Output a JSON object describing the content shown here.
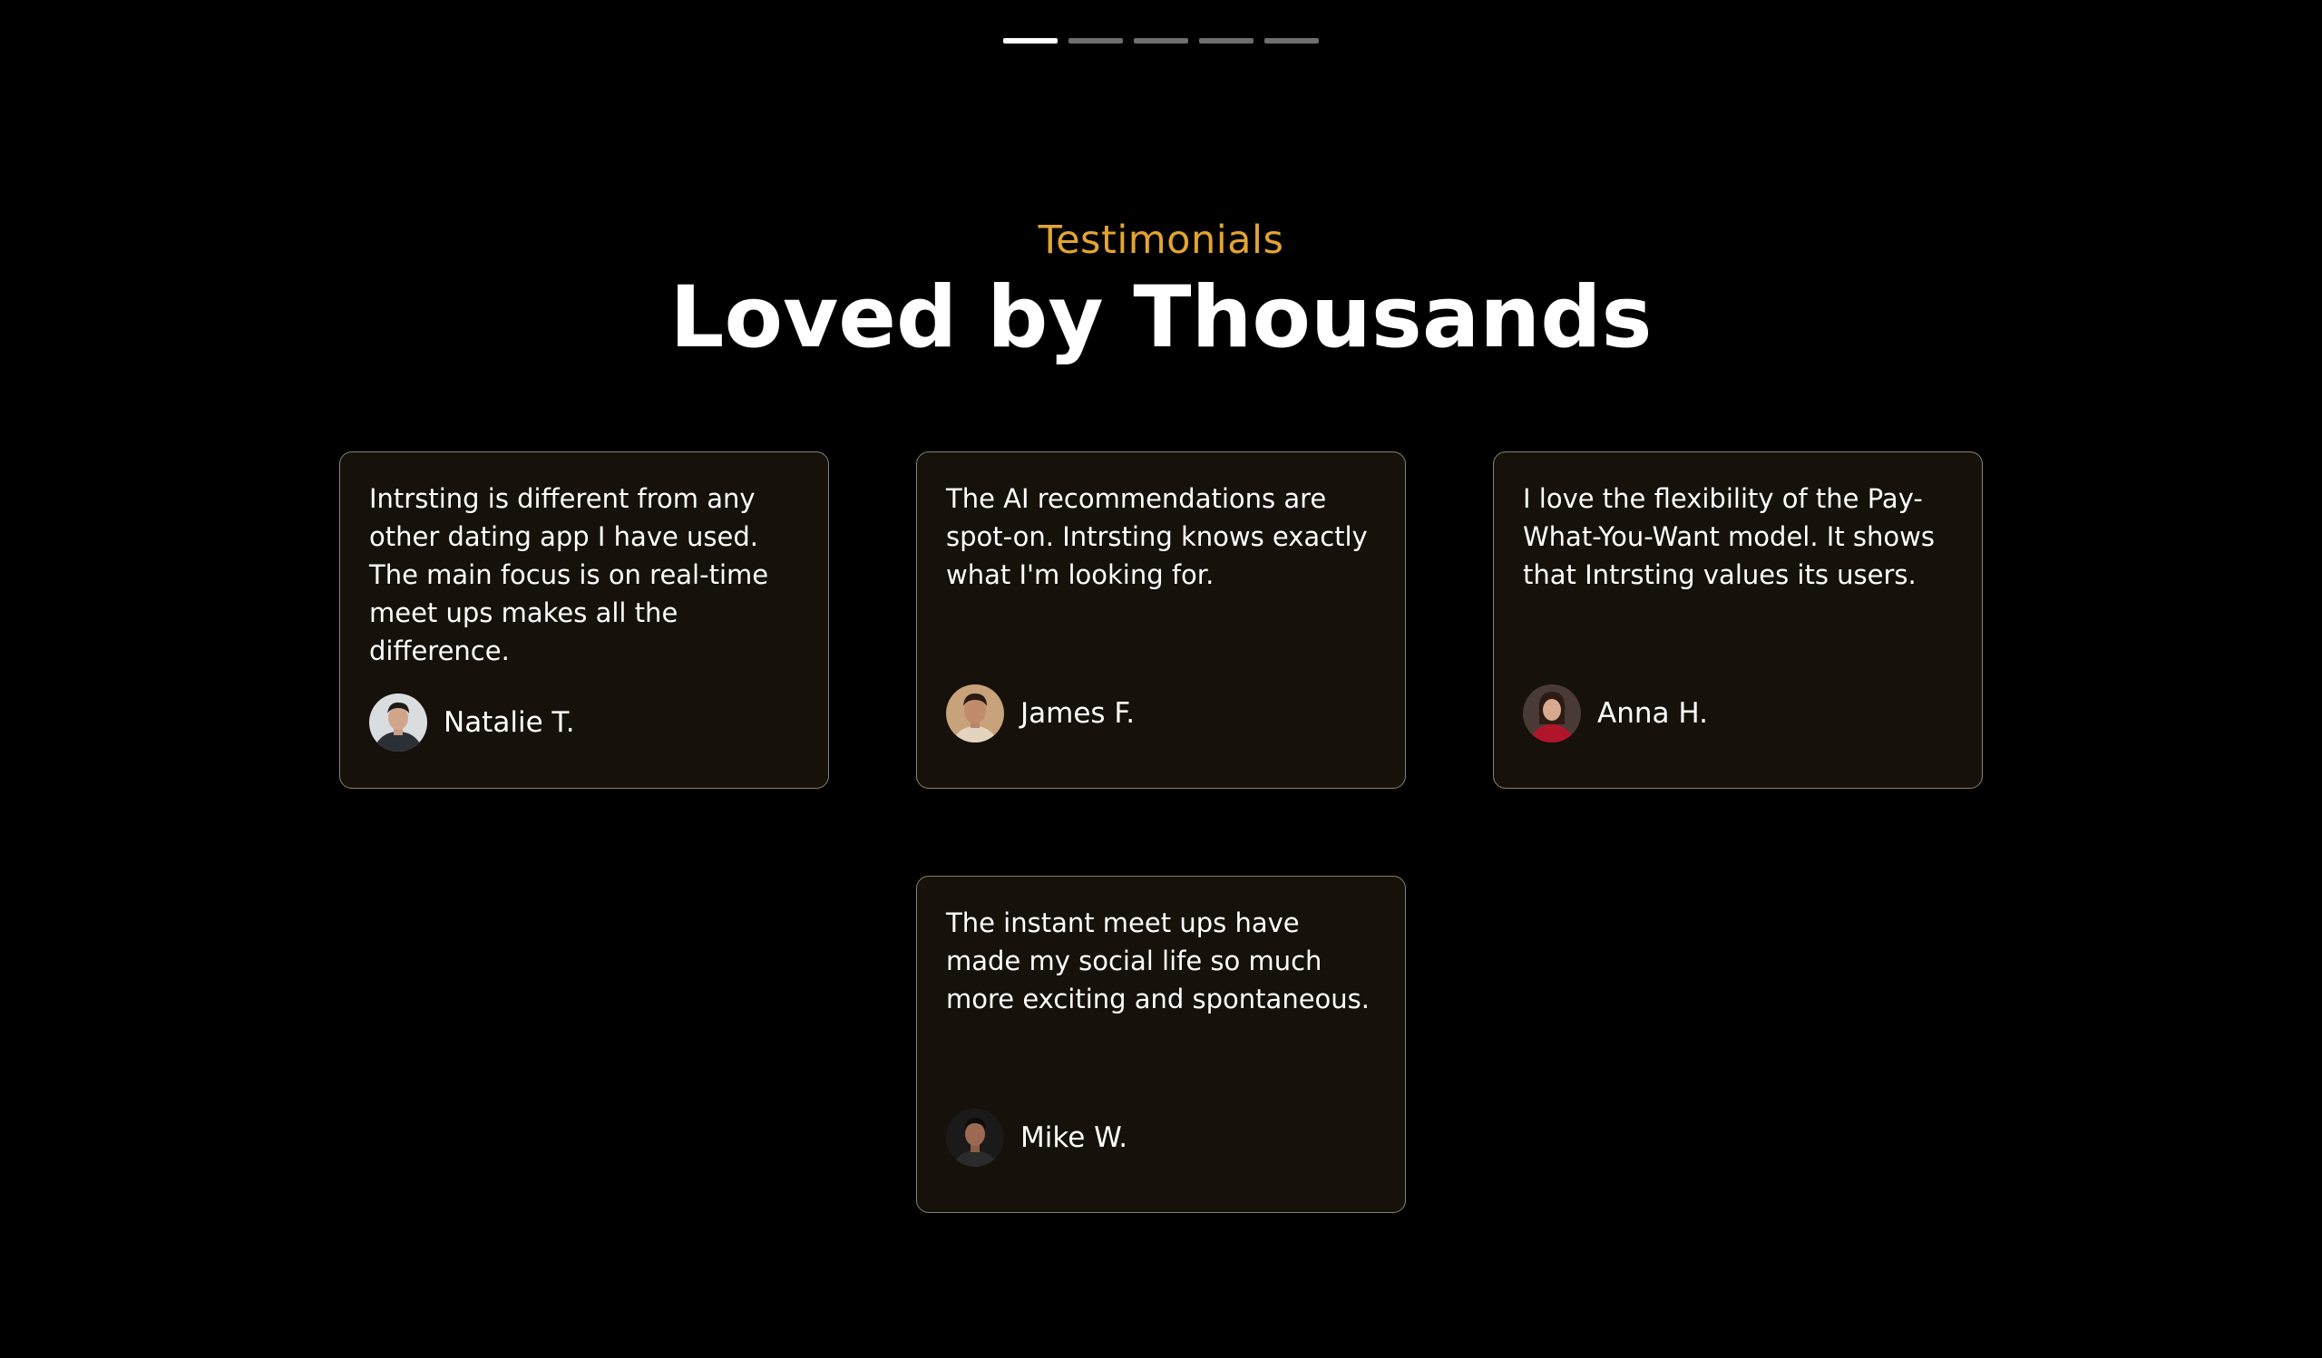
{
  "carousel": {
    "indicators": [
      {
        "label": "slide 1",
        "active": true
      },
      {
        "label": "slide 2",
        "active": false
      },
      {
        "label": "slide 3",
        "active": false
      },
      {
        "label": "slide 4",
        "active": false
      },
      {
        "label": "slide 5",
        "active": false
      }
    ]
  },
  "section": {
    "eyebrow": "Testimonials",
    "title": "Loved by Thousands"
  },
  "testimonials": [
    {
      "quote": "Intrsting is different from any other dating app I have used. The main focus is on real-time meet ups makes all the difference.",
      "name": "Natalie T.",
      "avatar_icon": "person-avatar"
    },
    {
      "quote": "The AI recommendations are spot-on. Intrsting knows exactly what I'm looking for.",
      "name": "James F.",
      "avatar_icon": "person-avatar"
    },
    {
      "quote": "I love the flexibility of the Pay-What-You-Want model. It shows that Intrsting values its users.",
      "name": "Anna H.",
      "avatar_icon": "person-avatar"
    },
    {
      "quote": "The instant meet ups have made my social life so much more exciting and spontaneous.",
      "name": "Mike W.",
      "avatar_icon": "person-avatar"
    }
  ],
  "colors": {
    "background": "#000000",
    "accent": "#e3a531",
    "card_background": "#16110a",
    "card_border": "#8a8070"
  }
}
